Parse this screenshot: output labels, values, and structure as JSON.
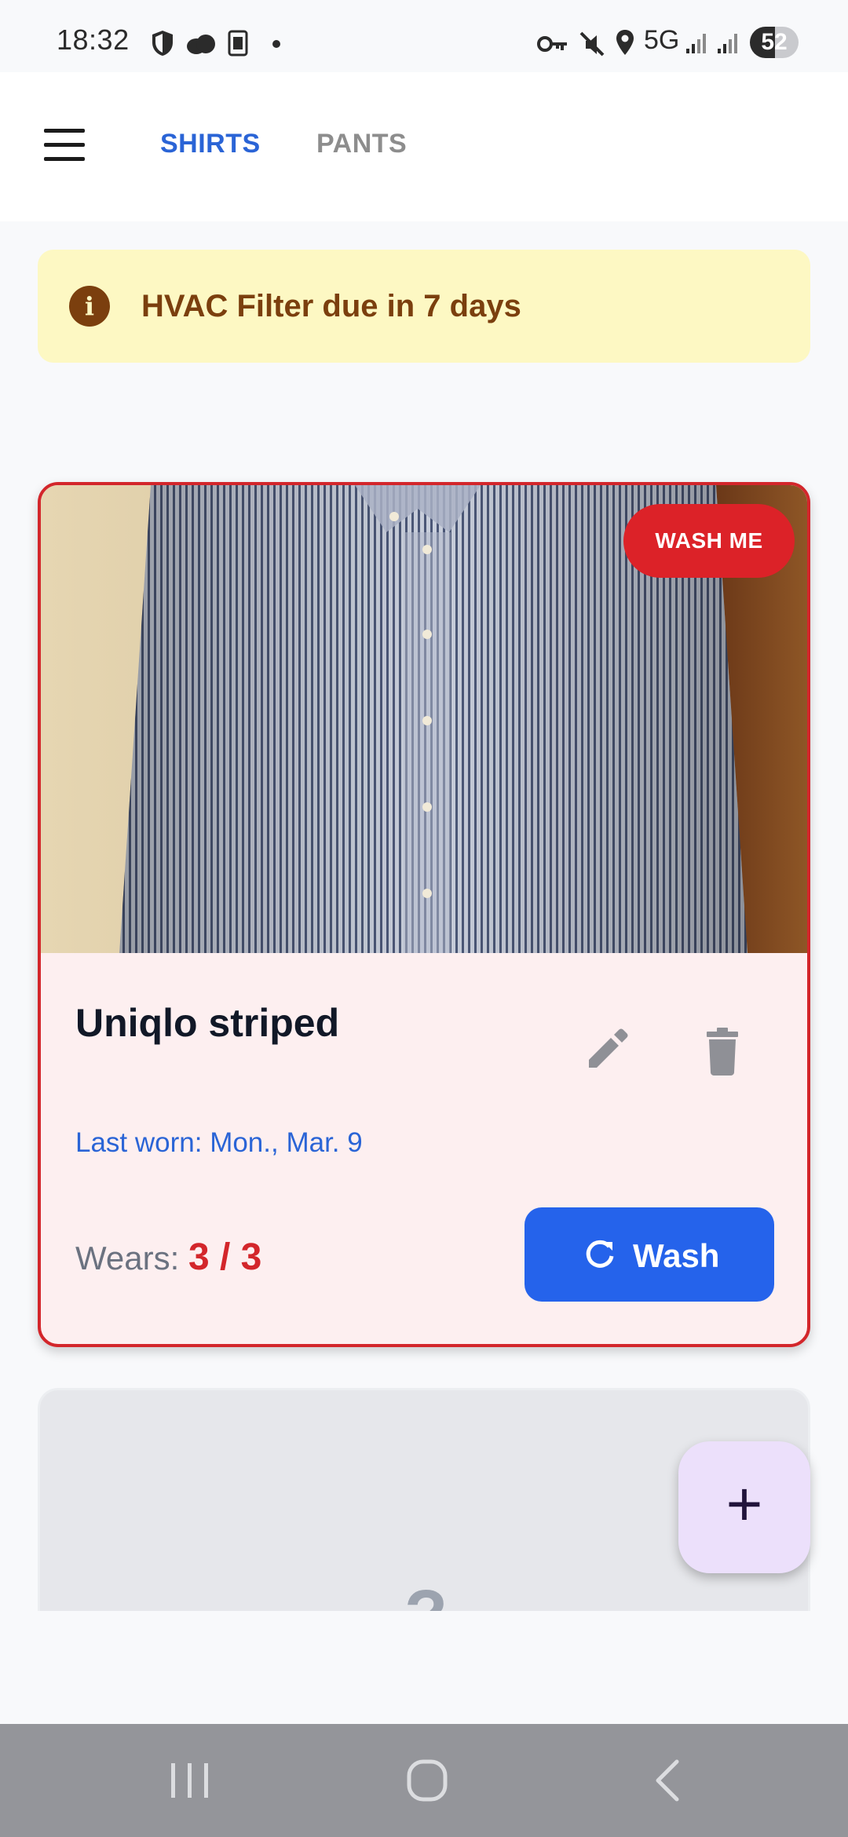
{
  "status_bar": {
    "time": "18:32",
    "network": "5G",
    "battery_level": "52",
    "battery_fraction": 0.52,
    "icons": [
      "shield-icon",
      "cloud-icon",
      "app-k-icon",
      "dot-icon",
      "key-icon",
      "mute-icon",
      "location-icon",
      "signal-icon",
      "signal-icon"
    ]
  },
  "app_bar": {
    "menu_icon": "hamburger-menu-icon",
    "tabs": [
      {
        "label": "SHIRTS",
        "active": true
      },
      {
        "label": "PANTS",
        "active": false
      }
    ],
    "active_color": "#2a64d6"
  },
  "alert": {
    "icon": "info-icon",
    "text": "HVAC Filter due in 7 days",
    "background": "#fdf8c3",
    "color": "#7b3f0e"
  },
  "items": [
    {
      "photo": "blue-striped-shirt-photo",
      "badge": "WASH ME",
      "title": "Uniqlo striped",
      "last_worn": "Last worn: Mon., Mar. 9",
      "wears_label": "Wears:",
      "wears_count": "3 / 3",
      "wash_label": "Wash",
      "accent": "#d3262b"
    },
    {
      "placeholder": "?"
    }
  ],
  "fab": {
    "label": "+",
    "icon": "plus-icon"
  },
  "nav": [
    "recents-icon",
    "home-icon",
    "back-icon"
  ]
}
